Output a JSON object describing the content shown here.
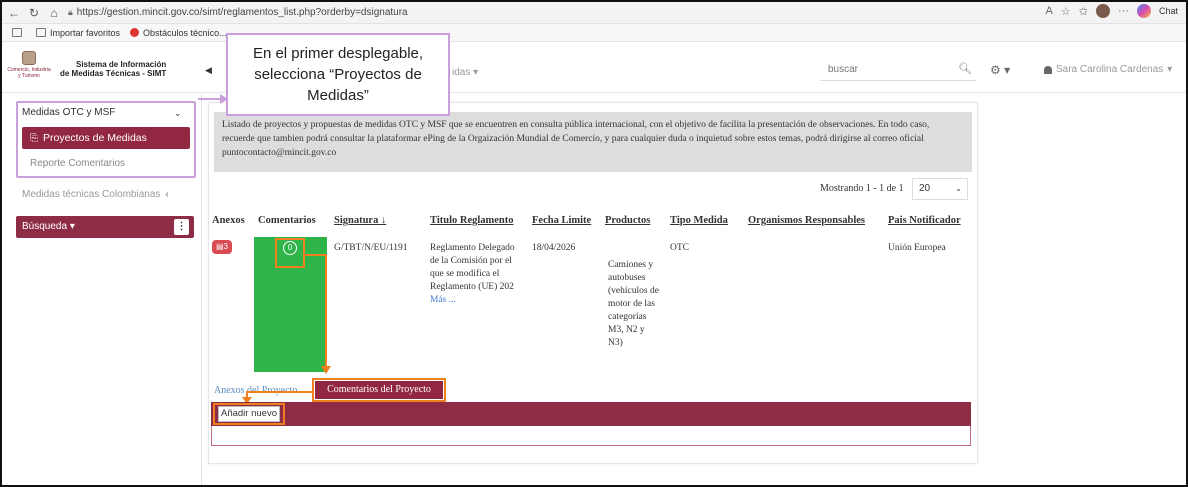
{
  "browser": {
    "url": "https://gestion.mincit.gov.co/simt/reglamentos_list.php?orderby=dsignatura",
    "chat_label": "Chat",
    "favorites": [
      "Importar favoritos",
      "Obstáculos técnico..."
    ]
  },
  "header": {
    "logo_text": "Comercio, Industria y Turismo",
    "system_title_line1": "Sistema de Información",
    "system_title_line2": "de Medidas Técnicas - SIMT",
    "menu_fragment": "idas",
    "search_placeholder": "buscar",
    "user_name": "Sara Carolina Cardenas"
  },
  "sidebar": {
    "group_label": "Medidas OTC y MSF",
    "active_item": "Proyectos de Medidas",
    "sub_item": "Reporte Comentarios",
    "colombian_item": "Medidas técnicas Colombianas",
    "search_button": "Búsqueda"
  },
  "callout": {
    "text": "En el primer desplegable, selecciona “Proyectos de Medidas”"
  },
  "notice": {
    "text": "Listado de proyectos y propuestas de medidas OTC y MSF que se encuentren en consulta pública internacional, con el objetivo de facilita la presentación de observaciones. En todo caso, recuerde que tambien podrá consultar la plataformar ePing de la Orgaización Mundial de Comercio, y para cualquier duda o inquietud sobre estos temas, podrá dirigirse al correo oficial puntocontacto@mincit.gov.co"
  },
  "pagination": {
    "showing": "Mostrando 1 - 1 de 1",
    "page_size": "20"
  },
  "table": {
    "headers": {
      "anexos": "Anexos",
      "comentarios": "Comentarios",
      "signatura": "Signatura",
      "titulo": "Titulo Reglamento",
      "fecha": "Fecha Limite",
      "productos": "Productos",
      "tipo": "Tipo Medida",
      "organismos": "Organismos Responsables",
      "pais": "Pais Notificador"
    },
    "row": {
      "anexos_count": "3",
      "comentarios_count": "0",
      "signatura": "G/TBT/N/EU/1191",
      "titulo": "Reglamento Delegado de la Comisión por el que se modifica el Reglamento (UE) 202",
      "more": "Más ...",
      "fecha": "18/04/2026",
      "productos": "Camiones y autobuses (vehículos de motor de las categorías M3, N2 y N3)",
      "tipo": "OTC",
      "pais": "Unión Europea"
    }
  },
  "tabs": {
    "annex": "Anexos del Proyecto",
    "comments": "Comentarios del Proyecto"
  },
  "comments_panel": {
    "add_button": "Añadir nuevo"
  }
}
